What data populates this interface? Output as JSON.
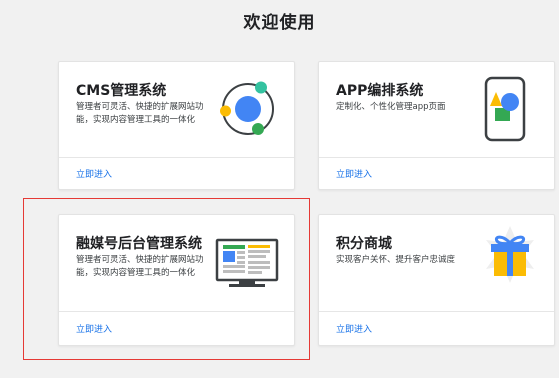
{
  "page": {
    "title": "欢迎使用"
  },
  "cards": [
    {
      "title": "CMS管理系统",
      "desc": "管理者可灵活、快捷的扩展网站功能，实现内容管理工具的一体化",
      "link": "立即进入",
      "icon": "cms-orbit-icon"
    },
    {
      "title": "APP编排系统",
      "desc": "定制化、个性化管理app页面",
      "link": "立即进入",
      "icon": "phone-shapes-icon"
    },
    {
      "title": "融媒号后台管理系统",
      "desc": "管理者可灵活、快捷的扩展网站功能，实现内容管理工具的一体化",
      "link": "立即进入",
      "icon": "monitor-dashboard-icon"
    },
    {
      "title": "积分商城",
      "desc": "实现客户关怀、提升客户忠诚度",
      "link": "立即进入",
      "icon": "gift-box-icon"
    }
  ],
  "colors": {
    "link": "#1a73e8",
    "highlight": "#e53935",
    "background": "#f1f1f1"
  }
}
